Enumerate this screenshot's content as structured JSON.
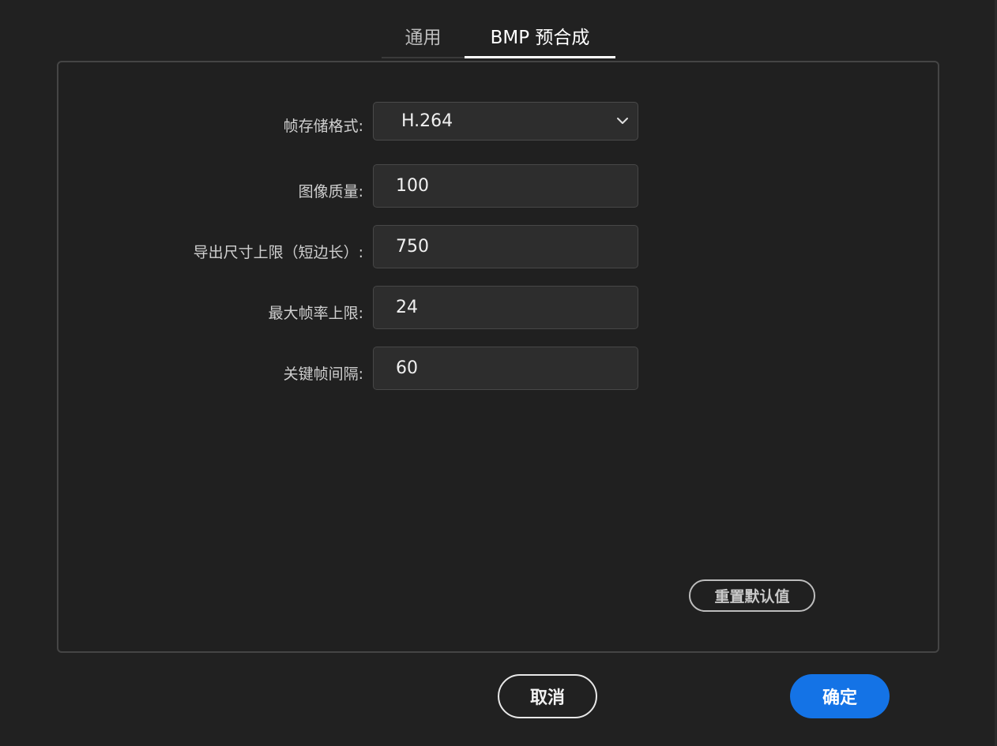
{
  "tabs": [
    {
      "label": "通用",
      "active": false
    },
    {
      "label": "BMP 预合成",
      "active": true
    }
  ],
  "form": {
    "frame_format": {
      "label": "帧存储格式:",
      "value": "H.264"
    },
    "image_quality": {
      "label": "图像质量:",
      "value": "100"
    },
    "export_size_limit": {
      "label": "导出尺寸上限（短边长）:",
      "value": "750"
    },
    "max_frame_rate": {
      "label": "最大帧率上限:",
      "value": "24"
    },
    "keyframe_interval": {
      "label": "关键帧间隔:",
      "value": "60"
    }
  },
  "buttons": {
    "reset": "重置默认值",
    "cancel": "取消",
    "ok": "确定"
  },
  "colors": {
    "background": "#212121",
    "accent": "#1473e6",
    "field_bg": "#2d2d2d",
    "panel_border": "#454545"
  },
  "icons": {
    "select_arrow": "chevron-down-icon"
  }
}
